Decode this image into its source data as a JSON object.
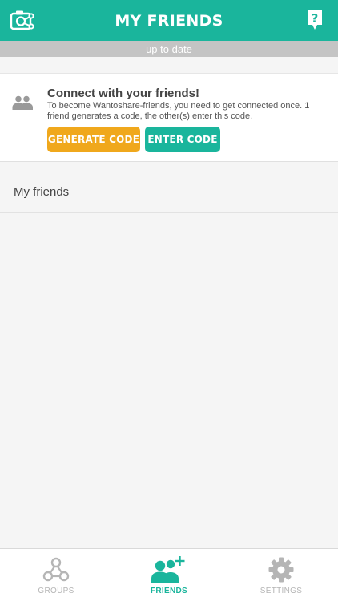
{
  "header": {
    "title": "MY FRIENDS",
    "left_icon": "camera-share-icon",
    "right_icon": "help-icon"
  },
  "status": {
    "text": "up to date"
  },
  "connect": {
    "icon": "people-icon",
    "title": "Connect with your friends!",
    "description": "To become Wantoshare-friends, you need to get connected once. 1 friend generates a code, the other(s) enter this code.",
    "generate_label": "GENERATE CODE",
    "enter_label": "ENTER CODE"
  },
  "friends_section": {
    "title": "My friends"
  },
  "tabs": [
    {
      "label": "GROUPS",
      "icon": "groups-icon"
    },
    {
      "label": "FRIENDS",
      "icon": "add-friend-icon",
      "active": true
    },
    {
      "label": "SETTINGS",
      "icon": "gear-icon"
    }
  ],
  "colors": {
    "accent": "#1ab59c",
    "generate": "#f0a81c",
    "status_strip": "#c4c4c4",
    "inactive_tab": "#b5b5b5"
  }
}
